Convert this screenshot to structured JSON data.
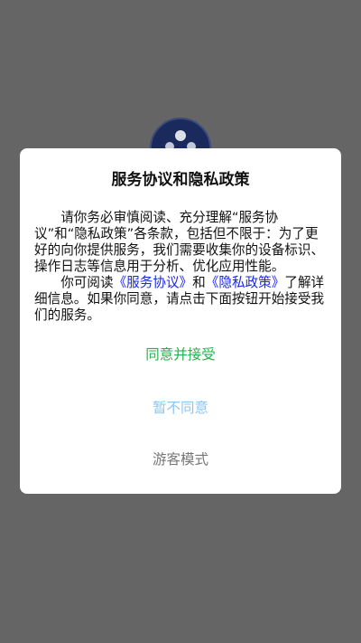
{
  "background": {
    "logo_icon": "app-logo-icon",
    "color": "#656565"
  },
  "dialog": {
    "title": "服务协议和隐私政策",
    "paragraph1": "请你务必审慎阅读、充分理解“服务协议”和“隐私政策”各条款，包括但不限于：为了更好的向你提供服务，我们需要收集你的设备标识、操作日志等信息用于分析、优化应用性能。",
    "paragraph2_prefix": "你可阅读",
    "service_link": "《服务协议》",
    "and_text": "和",
    "privacy_link": "《隐私政策》",
    "paragraph2_suffix": "了解详细信息。如果你同意，请点击下面按钮开始接受我们的服务。",
    "agree_button": "同意并接受",
    "disagree_button": "暂不同意",
    "guest_button": "游客模式"
  },
  "colors": {
    "agree": "#22b24c",
    "disagree": "#8ec6ee",
    "guest": "#777777",
    "link": "#1a27e6"
  }
}
